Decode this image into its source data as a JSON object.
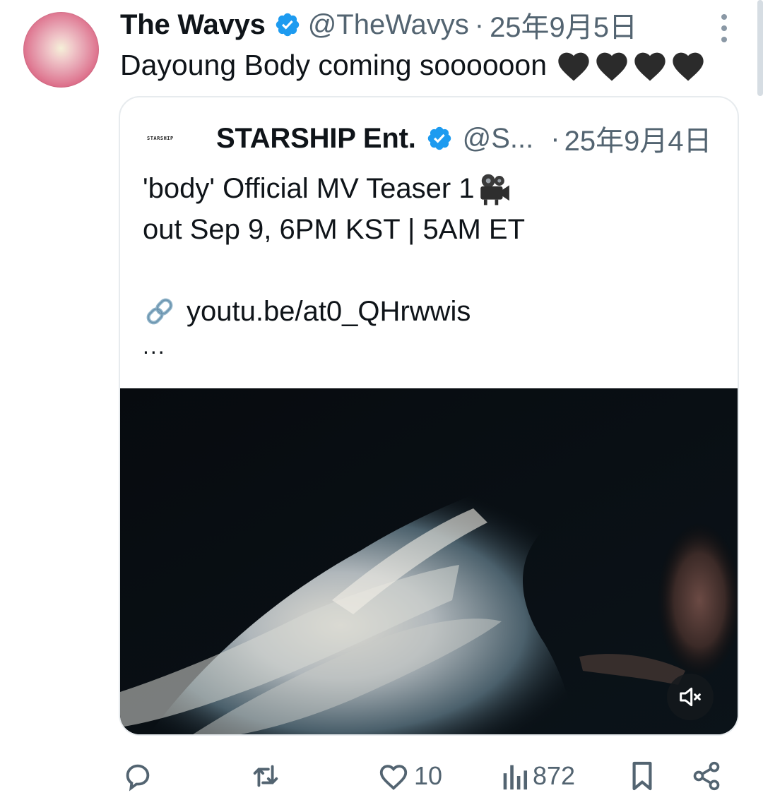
{
  "scrollbar_color": "#d6dde3",
  "tweet": {
    "author": {
      "display_name": "The Wavys",
      "handle": "@TheWavys",
      "verified": true,
      "avatar_icon": "pink-circle-avatar"
    },
    "separator": "·",
    "date": "25年9月5日",
    "text": "Dayoung Body coming soooooon",
    "emoji": [
      "black-heart",
      "black-heart",
      "black-heart",
      "black-heart"
    ],
    "more_icon": "vertical-ellipsis-icon"
  },
  "quoted": {
    "author": {
      "logo_text": "STARSHIP",
      "display_name": "STARSHIP Ent.",
      "handle": "@S...",
      "verified": true
    },
    "separator": "·",
    "date": "25年9月4日",
    "lines": [
      "'body' Official MV Teaser 1",
      "out Sep 9, 6PM KST | 5AM ET"
    ],
    "line1_emoji": "movie-camera",
    "link": "youtu.be/at0_QHrwwis",
    "ellipsis": "...",
    "media": {
      "type": "video",
      "mute_icon": "speaker-muted-icon"
    }
  },
  "actions": {
    "reply": {
      "icon": "reply-icon",
      "count": ""
    },
    "retweet": {
      "icon": "retweet-icon",
      "count": ""
    },
    "like": {
      "icon": "heart-icon",
      "count": "10"
    },
    "views": {
      "icon": "views-icon",
      "count": "872"
    },
    "bookmark": {
      "icon": "bookmark-icon"
    },
    "share": {
      "icon": "share-icon"
    }
  },
  "colors": {
    "text": "#0f1419",
    "secondary": "#536471",
    "verified": "#1d9bf0",
    "border": "#e7ebee"
  }
}
